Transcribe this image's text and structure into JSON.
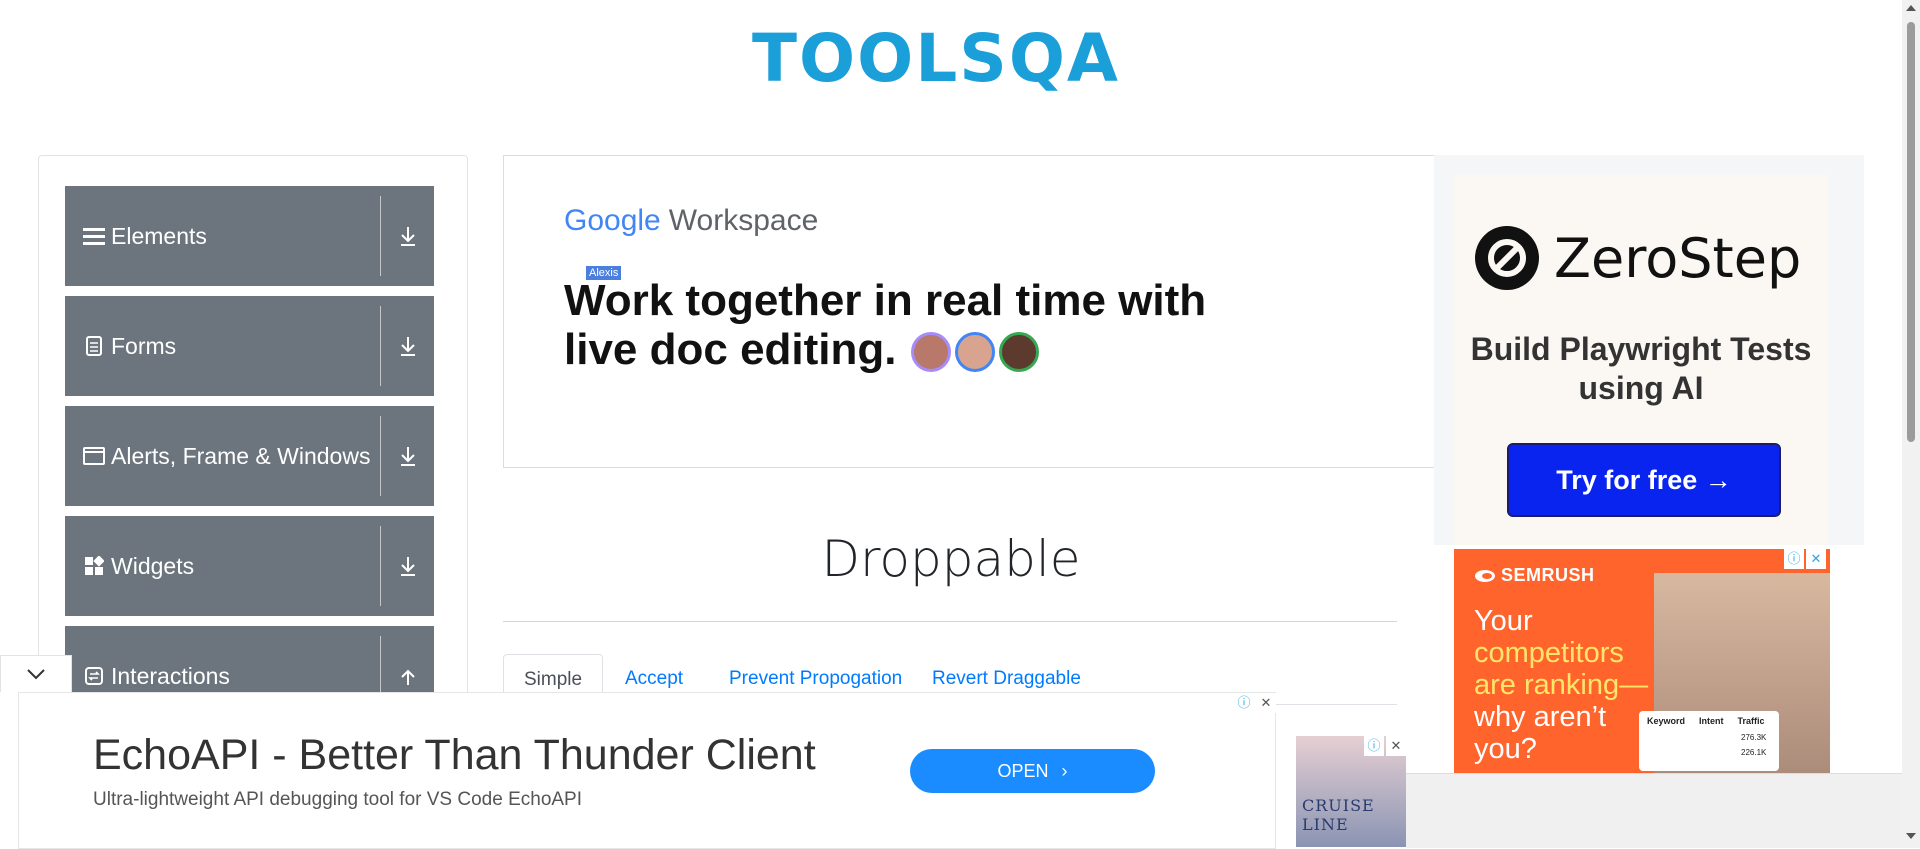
{
  "header": {
    "logo_text": "TOOLSQA"
  },
  "sidebar": {
    "groups": [
      {
        "label": "Elements",
        "icon": "hamburger-icon"
      },
      {
        "label": "Forms",
        "icon": "document-icon"
      },
      {
        "label": "Alerts, Frame & Windows",
        "icon": "window-icon"
      },
      {
        "label": "Widgets",
        "icon": "widgets-icon"
      },
      {
        "label": "Interactions",
        "icon": "interactions-icon"
      }
    ]
  },
  "gw_ad": {
    "brand_google": "Google",
    "brand_workspace": "Workspace",
    "tooltip": "Alexis",
    "headline": "Work together in real time with live doc editing."
  },
  "main": {
    "title": "Droppable",
    "tabs": [
      "Simple",
      "Accept",
      "Prevent Propogation",
      "Revert Draggable"
    ],
    "active_tab": "Simple"
  },
  "zerostep_ad": {
    "brand": "ZeroStep",
    "tagline": "Build Playwright Tests using AI",
    "cta": "Try for free →",
    "cta_color": "#0a24ef"
  },
  "semrush_ad": {
    "brand": "SEMRUSH",
    "text_white1": "Your",
    "text_yellow": "competitors are ranking—",
    "text_white2": "why aren’t you?",
    "card_headers": [
      "Keyword",
      "Intent",
      "Traffic"
    ],
    "card_values": [
      "276.3K",
      "226.1K"
    ]
  },
  "bottom_ad": {
    "title": "EchoAPI - Better Than Thunder Client",
    "subtitle": "Ultra-lightweight API debugging tool for VS Code EchoAPI",
    "button": "OPEN"
  },
  "cruise_ad": {
    "text": "CRUISE LINE"
  },
  "colors": {
    "sidebar_bg": "#6c757d",
    "link_blue": "#007bff",
    "semrush_orange": "#ff642d",
    "logo_blue": "#1a9fd9"
  }
}
